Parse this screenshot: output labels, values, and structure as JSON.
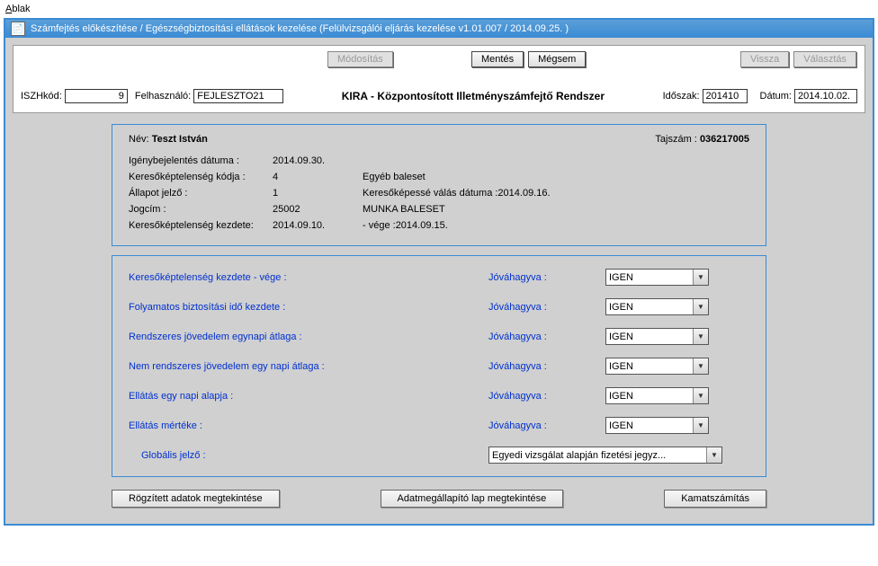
{
  "menu": {
    "label": "Ablak",
    "hotkey": "A",
    "rest": "blak"
  },
  "titlebar": {
    "text": "Számfejtés előkészítése / Egészségbiztosítási ellátások kezelése (Felülvizsgálói eljárás kezelése v1.01.007 / 2014.09.25. )"
  },
  "buttons": {
    "modositas": "Módosítás",
    "mentes": "Mentés",
    "megsem": "Mégsem",
    "vissza": "Vissza",
    "valasztas": "Választás",
    "rogzitett": "Rögzített adatok megtekintése",
    "adatmeg": "Adatmegállapító lap megtekintése",
    "kamat": "Kamatszámítás"
  },
  "header": {
    "iszhkod_label": "ISZHkód:",
    "iszhkod_value": "9",
    "felhasznalo_label": "Felhasználó:",
    "felhasznalo_value": "FEJLESZTO21",
    "center": "KIRA - Központosított Illetményszámfejtő Rendszer",
    "idoszak_label": "Időszak:",
    "idoszak_value": "201410",
    "datum_label": "Dátum:",
    "datum_value": "2014.10.02."
  },
  "panel1": {
    "nev_label": "Név:",
    "nev_value": "Teszt István",
    "taj_label": "Tajszám :",
    "taj_value": "036217005",
    "igeny_label": "Igénybejelentés dátuma :",
    "igeny_value": "2014.09.30.",
    "kerkod_label": "Keresőképtelenség kódja :",
    "kerkod_value": "4",
    "kerkod_desc": "Egyéb baleset",
    "allapot_label": "Állapot jelző :",
    "allapot_value": "1",
    "kervalt_label": "Keresőképessé válás dátuma :",
    "kervalt_value": "2014.09.16.",
    "jogcim_label": "Jogcím :",
    "jogcim_value": "25002",
    "jogcim_desc": "MUNKA BALESET",
    "kerkezd_label": "Keresőképtelenség kezdete:",
    "kerkezd_value": "2014.09.10.",
    "kervege_label": "- vége :",
    "kervege_value": "2014.09.15."
  },
  "panel2": {
    "rows": [
      {
        "label": "Keresőképtelenség kezdete - vége :",
        "jov": "Jóváhagyva :",
        "val": "IGEN"
      },
      {
        "label": "Folyamatos biztosítási idő kezdete :",
        "jov": "Jóváhagyva :",
        "val": "IGEN"
      },
      {
        "label": "Rendszeres jövedelem egynapi átlaga :",
        "jov": "Jóváhagyva :",
        "val": "IGEN"
      },
      {
        "label": "Nem rendszeres jövedelem egy napi átlaga :",
        "jov": "Jóváhagyva :",
        "val": "IGEN"
      },
      {
        "label": "Ellátás egy napi alapja :",
        "jov": "Jóváhagyva :",
        "val": "IGEN"
      },
      {
        "label": "Ellátás mértéke :",
        "jov": "Jóváhagyva :",
        "val": "IGEN"
      }
    ],
    "global_label": "Globális jelző :",
    "global_value": "Egyedi vizsgálat alapján fizetési jegyz..."
  }
}
